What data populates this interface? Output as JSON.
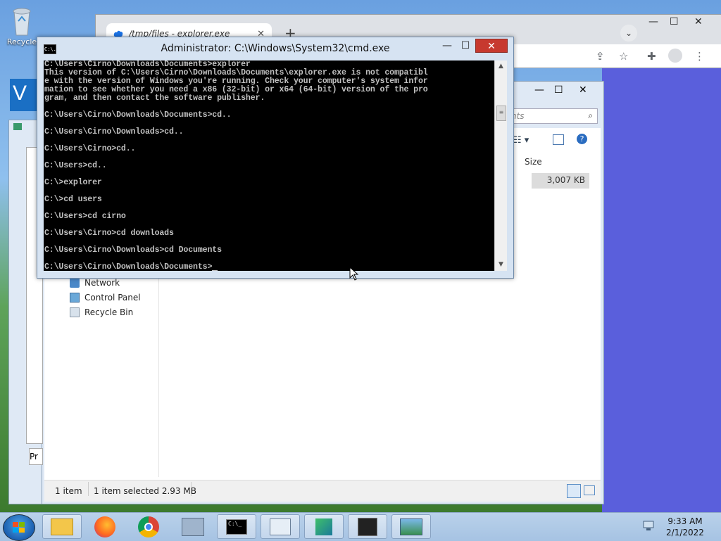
{
  "desktop": {
    "icons": [
      {
        "label": "Recycle"
      }
    ]
  },
  "chrome": {
    "tab_title": "/tmp/files - explorer.exe",
    "new_tab": "+",
    "minimize": "—",
    "maximize": "☐",
    "close": "✕"
  },
  "explorer": {
    "search_placeholder": "nts",
    "size_header": "Size",
    "size_value": "3,007 KB",
    "nav_items": [
      "Network",
      "Control Panel",
      "Recycle Bin"
    ],
    "status": {
      "items": "1 item",
      "selected": "1 item selected  2.93 MB"
    },
    "left_stub": "Pr"
  },
  "cmd": {
    "title": "Administrator: C:\\Windows\\System32\\cmd.exe",
    "icon_text": "C:\\.",
    "minimize": "—",
    "maximize": "☐",
    "close": "✕",
    "lines": [
      "C:\\Users\\Cirno\\Downloads\\Documents>explorer",
      "This version of C:\\Users\\Cirno\\Downloads\\Documents\\explorer.exe is not compatibl",
      "e with the version of Windows you're running. Check your computer's system infor",
      "mation to see whether you need a x86 (32-bit) or x64 (64-bit) version of the pro",
      "gram, and then contact the software publisher.",
      "",
      "C:\\Users\\Cirno\\Downloads\\Documents>cd..",
      "",
      "C:\\Users\\Cirno\\Downloads>cd..",
      "",
      "C:\\Users\\Cirno>cd..",
      "",
      "C:\\Users>cd..",
      "",
      "C:\\>explorer",
      "",
      "C:\\>cd users",
      "",
      "C:\\Users>cd cirno",
      "",
      "C:\\Users\\Cirno>cd downloads",
      "",
      "C:\\Users\\Cirno\\Downloads>cd Documents",
      "",
      "C:\\Users\\Cirno\\Downloads\\Documents>"
    ]
  },
  "taskbar": {
    "time": "9:33 AM",
    "date": "2/1/2022",
    "apps": [
      "file-explorer",
      "firefox",
      "chrome",
      "network-tool",
      "cmd",
      "performance-monitor",
      "download-tool",
      "terminal-tool",
      "image-viewer"
    ]
  },
  "colors": {
    "console_bg": "#000000",
    "console_fg": "#c0c0c0",
    "close_red": "#c7392f",
    "desktop_right": "#5a5fdc"
  }
}
